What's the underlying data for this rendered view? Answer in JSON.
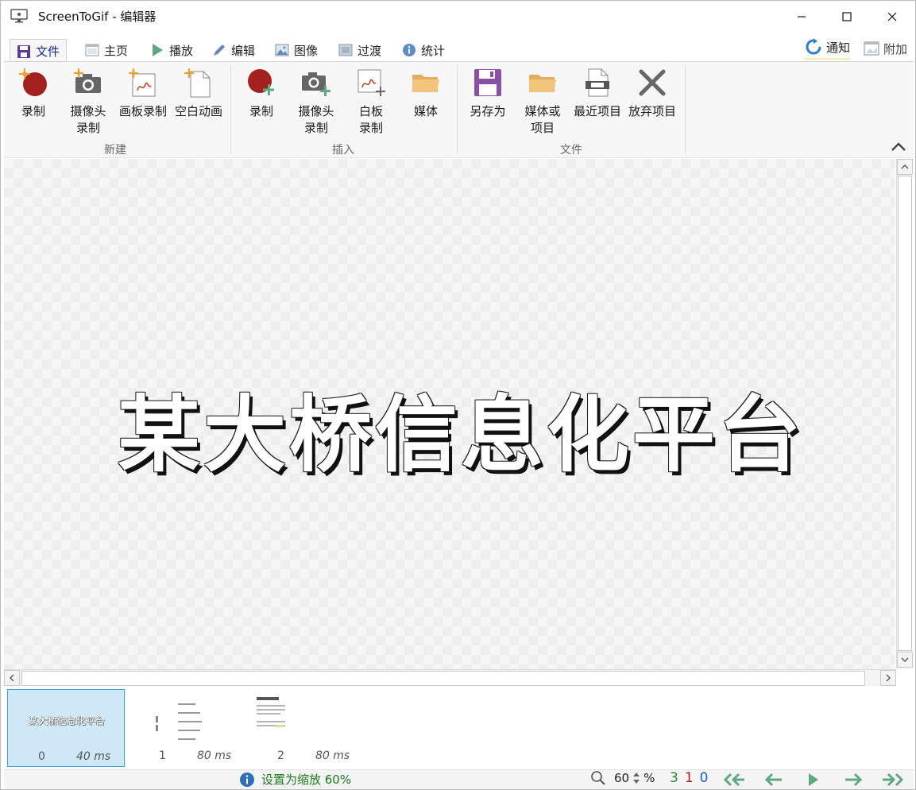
{
  "window": {
    "title": "ScreenToGif - 编辑器"
  },
  "tabs": [
    {
      "label": "文件",
      "icon": "save-icon",
      "active": true
    },
    {
      "label": "主页",
      "icon": "home-icon"
    },
    {
      "label": "播放",
      "icon": "play-icon"
    },
    {
      "label": "编辑",
      "icon": "pencil-icon"
    },
    {
      "label": "图像",
      "icon": "image-icon"
    },
    {
      "label": "过渡",
      "icon": "transition-icon"
    },
    {
      "label": "统计",
      "icon": "info-icon"
    }
  ],
  "tabs_right": {
    "notifications": "通知",
    "extras": "附加"
  },
  "ribbon": {
    "new_group": {
      "label": "新建",
      "record": "录制",
      "webcam_1": "摄像头",
      "webcam_2": "录制",
      "board": "画板录制",
      "blank": "空白动画"
    },
    "insert_group": {
      "label": "插入",
      "record": "录制",
      "webcam_1": "摄像头",
      "webcam_2": "录制",
      "board_1": "白板",
      "board_2": "录制",
      "media": "媒体"
    },
    "file_group": {
      "label": "文件",
      "save_as": "另存为",
      "load_1": "媒体或",
      "load_2": "项目",
      "recent": "最近项目",
      "discard": "放弃项目"
    }
  },
  "canvas": {
    "frame_text": "某大桥信息化平台"
  },
  "timeline": {
    "frames": [
      {
        "index": "0",
        "delay": "40 ms",
        "caption": "某大桥信息化平台"
      },
      {
        "index": "1",
        "delay": "80 ms"
      },
      {
        "index": "2",
        "delay": "80 ms"
      }
    ]
  },
  "statusbar": {
    "message": "设置为缩放 60%",
    "zoom_value": "60",
    "zoom_unit": "%",
    "count_total": "3",
    "count_selected": "1",
    "count_current": "0"
  },
  "colors": {
    "accent": "#1a2a8a",
    "record_red": "#a3201c",
    "save_purple": "#8a4fa6",
    "folder_yellow": "#f2c47c",
    "status_green": "#1d7a1d",
    "nav_green": "#5fa882"
  }
}
